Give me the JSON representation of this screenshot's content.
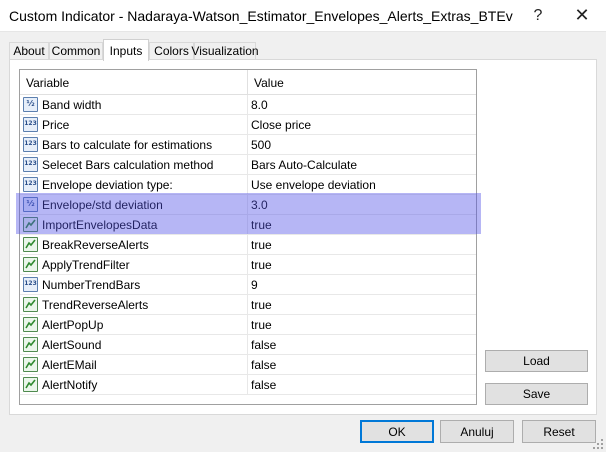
{
  "window": {
    "title": "Custom Indicator - Nadaraya-Watson_Estimator_Envelopes_Alerts_Extras_BTEv",
    "help_glyph": "?",
    "close_glyph": "✕"
  },
  "tabs": [
    {
      "label": "About",
      "active": false
    },
    {
      "label": "Common",
      "active": false
    },
    {
      "label": "Inputs",
      "active": true
    },
    {
      "label": "Colors",
      "active": false
    },
    {
      "label": "Visualization",
      "active": false
    }
  ],
  "grid": {
    "headers": {
      "variable": "Variable",
      "value": "Value"
    },
    "rows": [
      {
        "icon": "fraction-icon",
        "variable": "Band width",
        "value": "8.0"
      },
      {
        "icon": "integer-icon",
        "variable": "Price",
        "value": "Close price"
      },
      {
        "icon": "integer-icon",
        "variable": "Bars to calculate for estimations",
        "value": "500"
      },
      {
        "icon": "integer-icon",
        "variable": "Selecet Bars calculation method",
        "value": "Bars Auto-Calculate"
      },
      {
        "icon": "integer-icon",
        "variable": "Envelope deviation type:",
        "value": "Use envelope deviation"
      },
      {
        "icon": "fraction-icon",
        "variable": "Envelope/std deviation",
        "value": "3.0",
        "selected": true
      },
      {
        "icon": "boolean-icon",
        "variable": "ImportEnvelopesData",
        "value": "true",
        "selected": true
      },
      {
        "icon": "boolean-icon",
        "variable": "BreakReverseAlerts",
        "value": "true"
      },
      {
        "icon": "boolean-icon",
        "variable": "ApplyTrendFilter",
        "value": "true"
      },
      {
        "icon": "integer-icon",
        "variable": "NumberTrendBars",
        "value": "9"
      },
      {
        "icon": "boolean-icon",
        "variable": "TrendReverseAlerts",
        "value": "true"
      },
      {
        "icon": "boolean-icon",
        "variable": "AlertPopUp",
        "value": "true"
      },
      {
        "icon": "boolean-icon",
        "variable": "AlertSound",
        "value": "false"
      },
      {
        "icon": "boolean-icon",
        "variable": "AlertEMail",
        "value": "false"
      },
      {
        "icon": "boolean-icon",
        "variable": "AlertNotify",
        "value": "false"
      }
    ]
  },
  "side_buttons": {
    "load": "Load",
    "save": "Save"
  },
  "bottom_buttons": {
    "ok": "OK",
    "cancel": "Anuluj",
    "reset": "Reset"
  },
  "colors": {
    "selection": "#5050e6",
    "accent": "#0078d7"
  }
}
